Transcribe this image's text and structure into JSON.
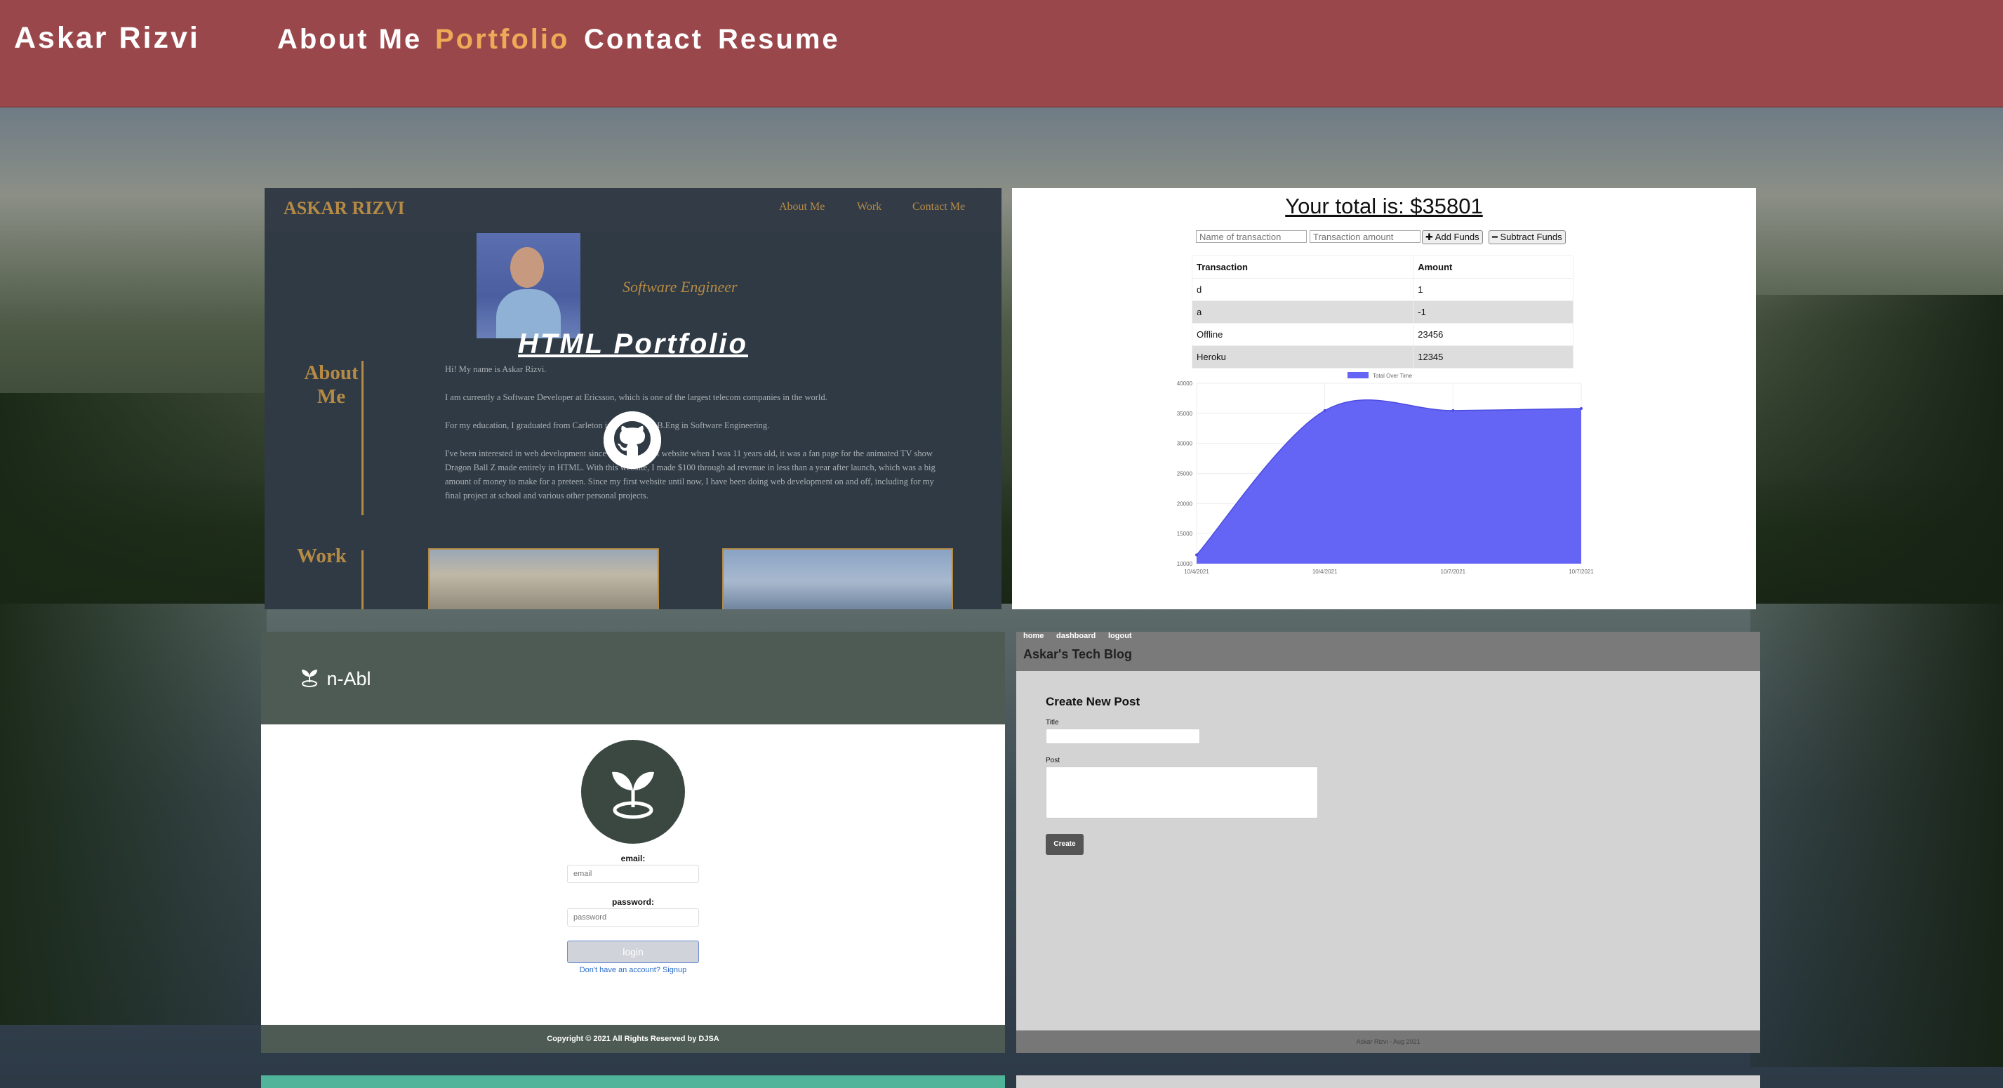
{
  "nav": {
    "brand": "Askar Rizvi",
    "links": [
      "About Me",
      "Portfolio",
      "Contact",
      "Resume"
    ],
    "active": "Portfolio"
  },
  "portfolio_card": {
    "site_brand": "ASKAR RIZVI",
    "site_nav": [
      "About Me",
      "Work",
      "Contact Me"
    ],
    "role": "Software Engineer",
    "overlay_title": "HTML Portfolio",
    "about_heading_1": "About",
    "about_heading_2": "Me",
    "paragraphs": [
      "Hi! My name is Askar Rizvi.",
      "I am currently a Software Developer at Ericsson, which is one of the largest telecom companies in the world.",
      "For my education, I graduated from Carleton in 2011 with a B.Eng in Software Engineering.",
      "I've been interested in web development since I built my first website when I was 11 years old, it was a fan page for the animated TV show Dragon Ball Z made entirely in HTML. With this website, I made $100 through ad revenue in less than a year after launch, which was a big amount of money to make for a preteen. Since my first website until now, I have been doing web development on and off, including for my final project at school and various other personal projects."
    ],
    "work_heading": "Work",
    "icon": "github-icon"
  },
  "budget_card": {
    "total_text": "Your total is: $35801",
    "name_placeholder": "Name of transaction",
    "amount_placeholder": "Transaction amount",
    "add_label": "✚ Add Funds",
    "subtract_label": "━ Subtract Funds",
    "table": {
      "headers": [
        "Transaction",
        "Amount"
      ],
      "rows": [
        [
          "d",
          "1"
        ],
        [
          "a",
          "-1"
        ],
        [
          "Offline",
          "23456"
        ],
        [
          "Heroku",
          "12345"
        ]
      ]
    }
  },
  "chart_data": {
    "type": "area",
    "legend": "Total Over Time",
    "legend_position": "top",
    "x": [
      "10/4/2021",
      "10/4/2021",
      "10/7/2021",
      "10/7/2021"
    ],
    "values": [
      11455,
      35458,
      35457,
      35801
    ],
    "ylim": [
      10000,
      40000
    ],
    "yticks": [
      10000,
      15000,
      20000,
      25000,
      30000,
      35000,
      40000
    ],
    "color": "#6464f5"
  },
  "nabl_card": {
    "logo_text": "n-Abl",
    "logo_icon": "sprout-icon",
    "email_label": "email:",
    "email_placeholder": "email",
    "password_label": "password:",
    "password_placeholder": "password",
    "login_label": "login",
    "signup_text": "Don't have an account? Signup",
    "footer": "Copyright © 2021 All Rights Reserved by DJSA"
  },
  "blog_card": {
    "links": [
      "home",
      "dashboard",
      "logout"
    ],
    "blog_title": "Askar's Tech Blog",
    "form_title": "Create New Post",
    "title_label": "Title",
    "post_label": "Post",
    "create_label": "Create",
    "footer": "Askar Rizvi - Aug 2021"
  }
}
